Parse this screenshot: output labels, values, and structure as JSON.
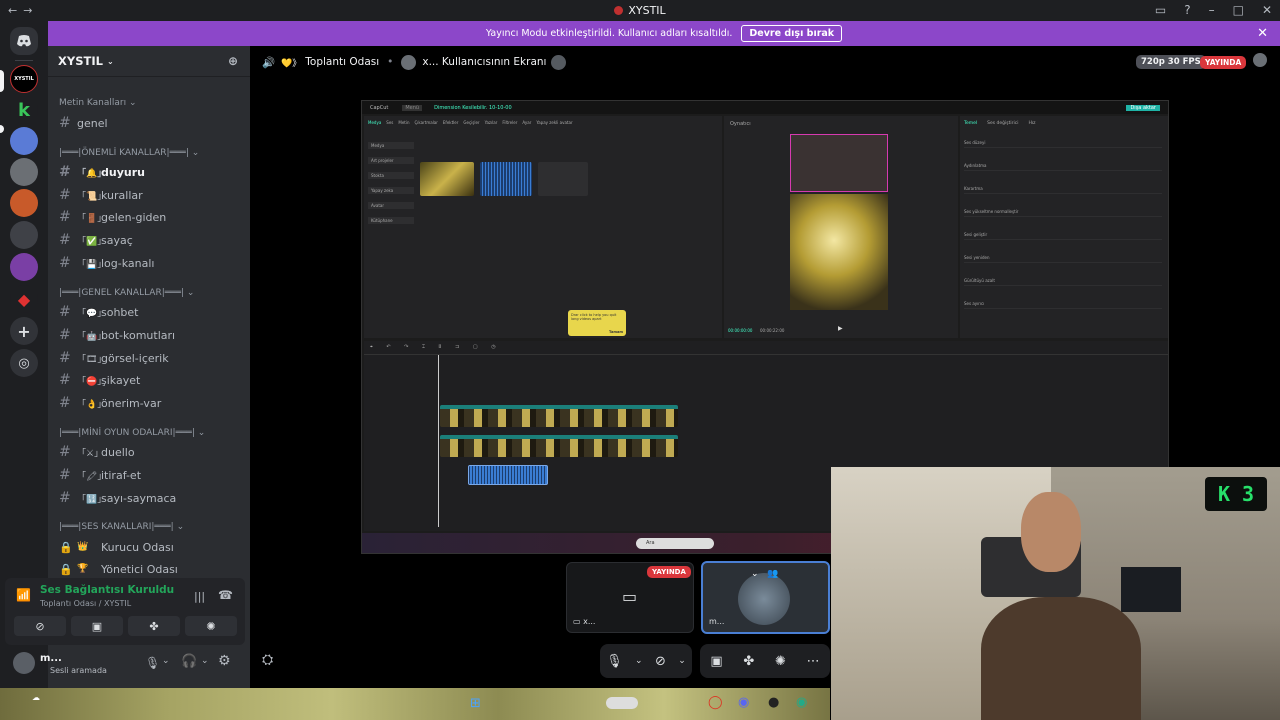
{
  "window": {
    "title": "XYSTIL"
  },
  "banner": {
    "text": "Yayıncı Modu etkinleştirildi. Kullanıcı adları kısaltıldı.",
    "button": "Devre dışı bırak"
  },
  "guild": {
    "name": "XYSTIL"
  },
  "categories": {
    "text": "Metin Kanalları",
    "important": "|═══|ÖNEMLİ KANALLAR|═══|",
    "general": "|═══|GENEL KANALLAR|═══|",
    "mini": "|═══|MİNİ OYUN ODALARI|═══|",
    "voice": "|═══|SES KANALLARI|═══|"
  },
  "channels": {
    "genel": "genel",
    "duyuru": "duyuru",
    "kurallar": "kurallar",
    "gelen_giden": "gelen-giden",
    "sayac": "sayaç",
    "log": "log-kanalı",
    "sohbet": "sohbet",
    "bot": "bot-komutları",
    "gorsel": "görsel-içerik",
    "sikayet": "şikayet",
    "oneri": "önerim-var",
    "duello": "duello",
    "itiraf": "itiraf-et",
    "sayi": "sayı-saymaca",
    "kurucu": "Kurucu Odası",
    "yonetici": "Yönetici Odası"
  },
  "voice": {
    "status": "Ses Bağlantısı Kuruldu",
    "location": "Toplantı Odası / XYSTIL"
  },
  "user": {
    "name": "m...",
    "status": "Sesli aramada"
  },
  "header": {
    "channel": "Toplantı Odası",
    "stream": "x... Kullanıcısının Ekranı",
    "quality": "720p 30 FPS",
    "live": "YAYINDA"
  },
  "tiles": {
    "live": "YAYINDA",
    "tile1_user": "x...",
    "tile2_user": "m..."
  },
  "stream": {
    "app_title": "Dimension Kesilebilir. 10-10-00",
    "toolbar": [
      "Medya",
      "Ses",
      "Metin",
      "Çıkartmalar",
      "Efektler",
      "Geçişler",
      "Yazılar",
      "Filtreler",
      "Ayar",
      "Yapay zekli avatar"
    ],
    "side": [
      "Medya",
      "Art projeler",
      "Stokta",
      "Yapay zeka",
      "Avatar",
      "Kütüphane"
    ],
    "player_label": "Oynatıcı",
    "right_tabs": [
      "Temel",
      "Ses değiştirici",
      "Hız"
    ],
    "right_rows": [
      "Ses düzeyi",
      "Aydınlatma",
      "Karartma",
      "Ses yükseltme normalleştir",
      "Sesi geliştir",
      "Sesi yeniden",
      "Gürültüyü azalt",
      "Ses ayırıcı"
    ],
    "tooltip": "Drar click to help you quit long videos apart",
    "tooltip_btn": "Tamam",
    "timecode": "00:00:00:00",
    "duration": "00:00:22:00",
    "search": "Ara"
  },
  "cam": {
    "overlay": "K 3"
  },
  "colors": {
    "banner": "#8c47c9",
    "live": "#da373c",
    "voice_green": "#23a55a",
    "sidebar": "#2b2d31"
  }
}
